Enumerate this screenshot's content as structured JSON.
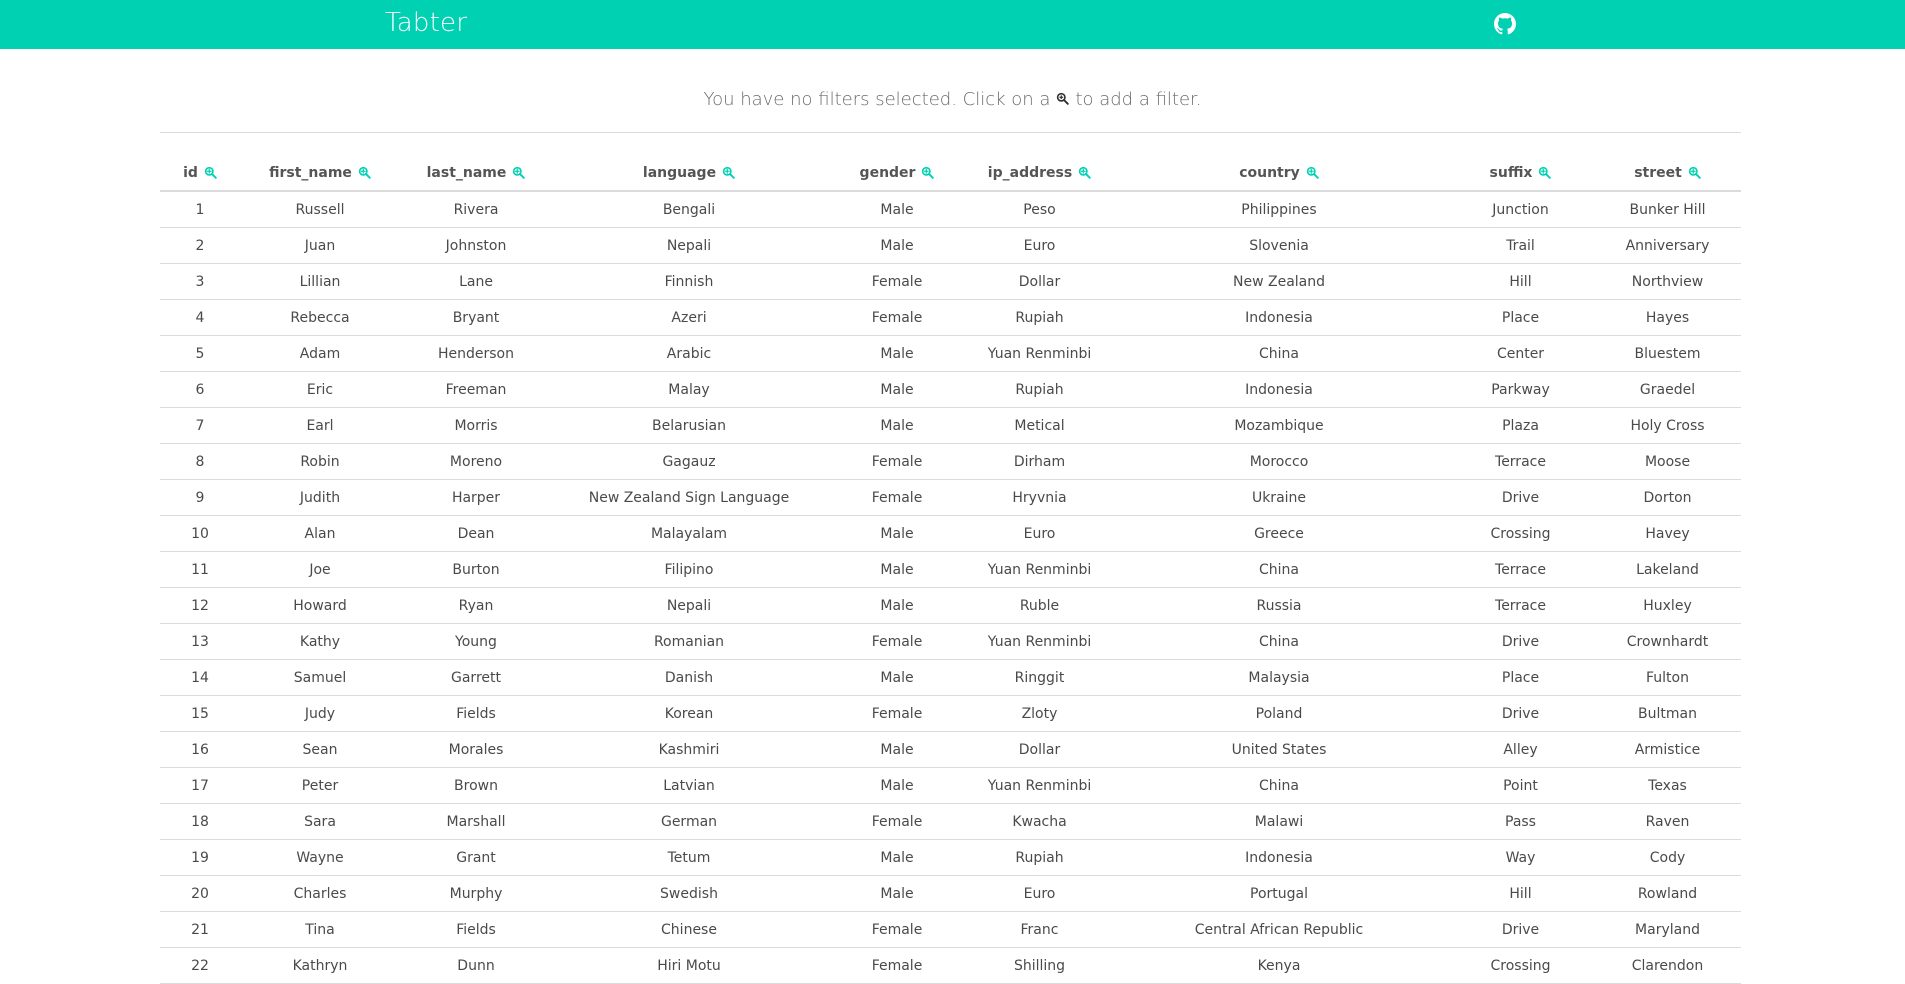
{
  "app": {
    "title": "Tabter",
    "icons": {
      "brand_link": "github-icon",
      "filter": "search-plus-icon"
    },
    "colors": {
      "navbar": "#00d1b2",
      "accent": "#00d1b2"
    }
  },
  "filters": {
    "message_before": "You have no filters selected. Click on a",
    "message_after": "to add a filter."
  },
  "table": {
    "columns": [
      "id",
      "first_name",
      "last_name",
      "language",
      "gender",
      "ip_address",
      "country",
      "suffix",
      "street"
    ],
    "rows": [
      [
        "1",
        "Russell",
        "Rivera",
        "Bengali",
        "Male",
        "Peso",
        "Philippines",
        "Junction",
        "Bunker Hill"
      ],
      [
        "2",
        "Juan",
        "Johnston",
        "Nepali",
        "Male",
        "Euro",
        "Slovenia",
        "Trail",
        "Anniversary"
      ],
      [
        "3",
        "Lillian",
        "Lane",
        "Finnish",
        "Female",
        "Dollar",
        "New Zealand",
        "Hill",
        "Northview"
      ],
      [
        "4",
        "Rebecca",
        "Bryant",
        "Azeri",
        "Female",
        "Rupiah",
        "Indonesia",
        "Place",
        "Hayes"
      ],
      [
        "5",
        "Adam",
        "Henderson",
        "Arabic",
        "Male",
        "Yuan Renminbi",
        "China",
        "Center",
        "Bluestem"
      ],
      [
        "6",
        "Eric",
        "Freeman",
        "Malay",
        "Male",
        "Rupiah",
        "Indonesia",
        "Parkway",
        "Graedel"
      ],
      [
        "7",
        "Earl",
        "Morris",
        "Belarusian",
        "Male",
        "Metical",
        "Mozambique",
        "Plaza",
        "Holy Cross"
      ],
      [
        "8",
        "Robin",
        "Moreno",
        "Gagauz",
        "Female",
        "Dirham",
        "Morocco",
        "Terrace",
        "Moose"
      ],
      [
        "9",
        "Judith",
        "Harper",
        "New Zealand Sign Language",
        "Female",
        "Hryvnia",
        "Ukraine",
        "Drive",
        "Dorton"
      ],
      [
        "10",
        "Alan",
        "Dean",
        "Malayalam",
        "Male",
        "Euro",
        "Greece",
        "Crossing",
        "Havey"
      ],
      [
        "11",
        "Joe",
        "Burton",
        "Filipino",
        "Male",
        "Yuan Renminbi",
        "China",
        "Terrace",
        "Lakeland"
      ],
      [
        "12",
        "Howard",
        "Ryan",
        "Nepali",
        "Male",
        "Ruble",
        "Russia",
        "Terrace",
        "Huxley"
      ],
      [
        "13",
        "Kathy",
        "Young",
        "Romanian",
        "Female",
        "Yuan Renminbi",
        "China",
        "Drive",
        "Crownhardt"
      ],
      [
        "14",
        "Samuel",
        "Garrett",
        "Danish",
        "Male",
        "Ringgit",
        "Malaysia",
        "Place",
        "Fulton"
      ],
      [
        "15",
        "Judy",
        "Fields",
        "Korean",
        "Female",
        "Zloty",
        "Poland",
        "Drive",
        "Bultman"
      ],
      [
        "16",
        "Sean",
        "Morales",
        "Kashmiri",
        "Male",
        "Dollar",
        "United States",
        "Alley",
        "Armistice"
      ],
      [
        "17",
        "Peter",
        "Brown",
        "Latvian",
        "Male",
        "Yuan Renminbi",
        "China",
        "Point",
        "Texas"
      ],
      [
        "18",
        "Sara",
        "Marshall",
        "German",
        "Female",
        "Kwacha",
        "Malawi",
        "Pass",
        "Raven"
      ],
      [
        "19",
        "Wayne",
        "Grant",
        "Tetum",
        "Male",
        "Rupiah",
        "Indonesia",
        "Way",
        "Cody"
      ],
      [
        "20",
        "Charles",
        "Murphy",
        "Swedish",
        "Male",
        "Euro",
        "Portugal",
        "Hill",
        "Rowland"
      ],
      [
        "21",
        "Tina",
        "Fields",
        "Chinese",
        "Female",
        "Franc",
        "Central African Republic",
        "Drive",
        "Maryland"
      ],
      [
        "22",
        "Kathryn",
        "Dunn",
        "Hiri Motu",
        "Female",
        "Shilling",
        "Kenya",
        "Crossing",
        "Clarendon"
      ]
    ]
  }
}
